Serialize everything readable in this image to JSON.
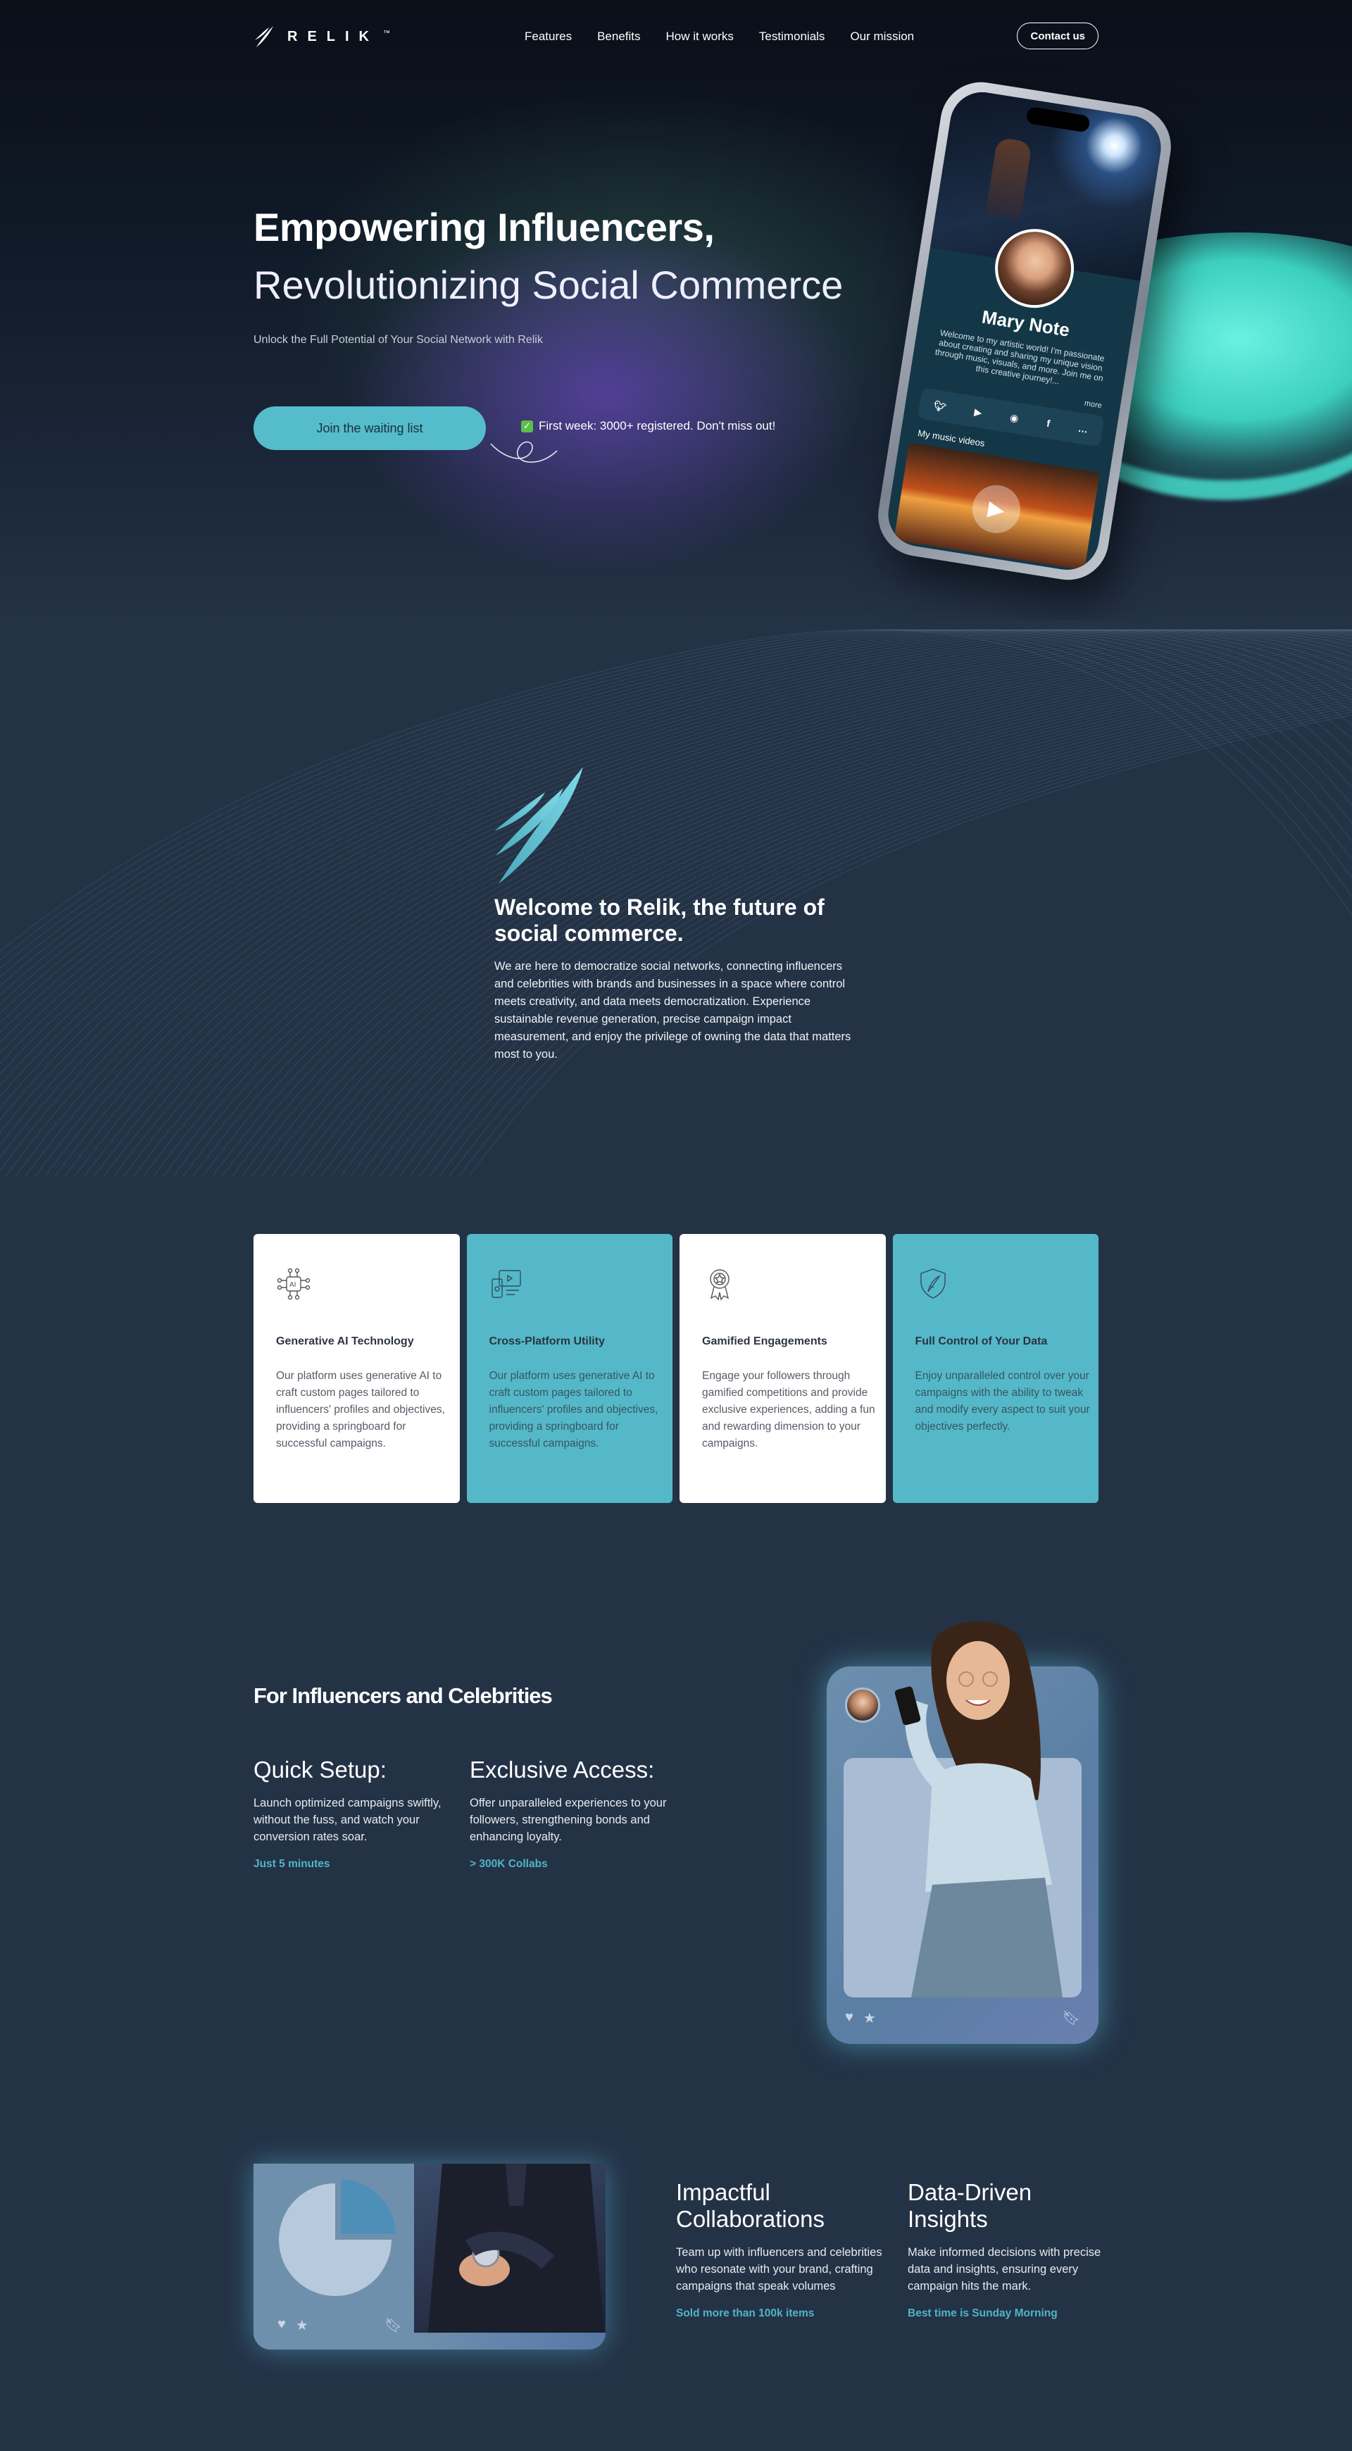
{
  "nav": {
    "logo_text": "RELIK",
    "logo_tm": "™",
    "links": [
      "Features",
      "Benefits",
      "How it works",
      "Testimonials",
      "Our mission"
    ],
    "contact": "Contact us"
  },
  "hero": {
    "title_bold": "Empowering Influencers,",
    "title_light": "Revolutionizing Social Commerce",
    "subtitle": "Unlock the Full Potential of Your Social Network with Relik",
    "cta": "Join the waiting list",
    "note": "First week: 3000+ registered. Don't miss out!"
  },
  "phone": {
    "name": "Mary Note",
    "bio": "Welcome to my artistic world! I'm passionate about creating and sharing my unique vision through music, visuals, and more. Join me on this creative journey!...",
    "more": "more",
    "social": [
      "twitter-icon",
      "youtube-icon",
      "spotify-icon",
      "facebook-icon",
      "more-icon"
    ],
    "videos_label": "My music videos"
  },
  "welcome": {
    "title": "Welcome to Relik, the future of social commerce.",
    "text": "We are here to democratize social networks, connecting influencers and celebrities with brands and businesses in a space where control meets creativity, and data meets democratization. Experience sustainable revenue generation, precise campaign impact measurement, and enjoy the privilege of owning the data that matters most to you."
  },
  "cards": [
    {
      "title": "Generative AI Technology",
      "text": "Our platform uses generative AI to craft custom pages tailored to influencers' profiles and objectives, providing a springboard for successful campaigns.",
      "icon": "ai-chip-icon"
    },
    {
      "title": "Cross-Platform Utility",
      "text": "Our platform uses generative AI to craft custom pages tailored to influencers' profiles and objectives, providing a springboard for successful campaigns.",
      "icon": "devices-icon"
    },
    {
      "title": "Gamified Engagements",
      "text": "Engage your followers through gamified competitions and provide exclusive experiences, adding a fun and rewarding dimension to your campaigns.",
      "icon": "award-badge-icon"
    },
    {
      "title": "Full Control of Your Data",
      "text": "Enjoy unparalleled control over your campaigns with the ability to tweak and modify every aspect to suit your objectives perfectly.",
      "icon": "shield-feather-icon"
    }
  ],
  "influencers": {
    "title": "For Influencers and Celebrities",
    "features": [
      {
        "title": "Quick Setup:",
        "text": "Launch optimized campaigns swiftly, without the fuss, and watch your conversion rates soar.",
        "tag": "Just 5 minutes"
      },
      {
        "title": "Exclusive Access:",
        "text": "Offer unparalleled experiences to your followers, strengthening bonds and enhancing loyalty.",
        "tag": "> 300K Collabs"
      }
    ]
  },
  "brands": {
    "features": [
      {
        "title": "Impactful Collaborations",
        "text": "Team up with influencers and celebrities who resonate with your brand, crafting campaigns that speak volumes",
        "tag": "Sold more than 100k items"
      },
      {
        "title": "Data-Driven Insights",
        "text": "Make informed decisions with precise data and insights, ensuring every campaign hits the mark.",
        "tag": "Best time is Sunday Morning"
      }
    ]
  },
  "colors": {
    "teal": "#54b8c8",
    "accent_text": "#4fb5c6",
    "background": "#243246",
    "cta": "#55bccb"
  }
}
